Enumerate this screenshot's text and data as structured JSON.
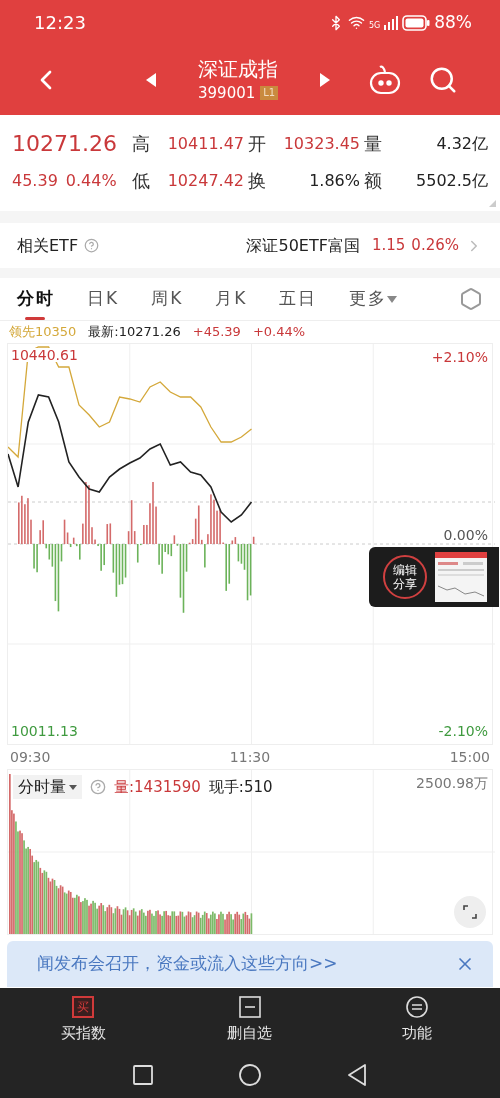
{
  "status_bar": {
    "time": "12:23",
    "network": "5G",
    "battery": "88%"
  },
  "header": {
    "title": "深证成指",
    "code": "399001",
    "level_badge": "L1"
  },
  "quote": {
    "price": "10271.26",
    "change": "45.39",
    "change_pct": "0.44%",
    "stats": [
      {
        "label": "高",
        "value": "10411.47",
        "color": "#c9383a"
      },
      {
        "label": "开",
        "value": "10323.45",
        "color": "#c9383a"
      },
      {
        "label": "量",
        "value": "4.32亿",
        "color": "#222222"
      },
      {
        "label": "低",
        "value": "10247.42",
        "color": "#c9383a"
      },
      {
        "label": "换",
        "value": "1.86%",
        "color": "#222222"
      },
      {
        "label": "额",
        "value": "5502.5亿",
        "color": "#222222"
      }
    ]
  },
  "etf": {
    "label": "相关ETF",
    "name": "深证50ETF富国",
    "price": "1.15",
    "change_pct": "0.26%"
  },
  "tabs": [
    {
      "label": "分时",
      "kind": "tab",
      "selected": true
    },
    {
      "label": "日K",
      "kind": "tab",
      "selected": false
    },
    {
      "label": "周K",
      "kind": "tab",
      "selected": false
    },
    {
      "label": "月K",
      "kind": "tab",
      "selected": false
    },
    {
      "label": "五日",
      "kind": "tab",
      "selected": false
    },
    {
      "label": "更多",
      "kind": "dropdown",
      "selected": false
    }
  ],
  "chart_info": {
    "lead": "领先10350",
    "latest": "最新:10271.26",
    "change": "+45.39",
    "change_pct": "+0.44%"
  },
  "price_chart": {
    "left_labels": [
      "10440.61",
      "10011.13"
    ],
    "right_labels": [
      "+2.10%",
      "0.00%",
      "-2.10%"
    ],
    "time_labels": [
      "09:30",
      "11:30",
      "15:00"
    ]
  },
  "share_popup": {
    "label": "编辑分享"
  },
  "volume": {
    "indicator": "分时量",
    "volume": "量:1431590",
    "current": "现手:510",
    "max": "2500.98万"
  },
  "news_banner": {
    "text": "闻发布会召开，资金或流入这些方向>>"
  },
  "bottom_tabs": [
    {
      "label": "买指数",
      "kind": "buy",
      "icon_text": "买"
    },
    {
      "label": "删自选",
      "kind": "remove"
    },
    {
      "label": "功能",
      "kind": "menu"
    }
  ]
}
